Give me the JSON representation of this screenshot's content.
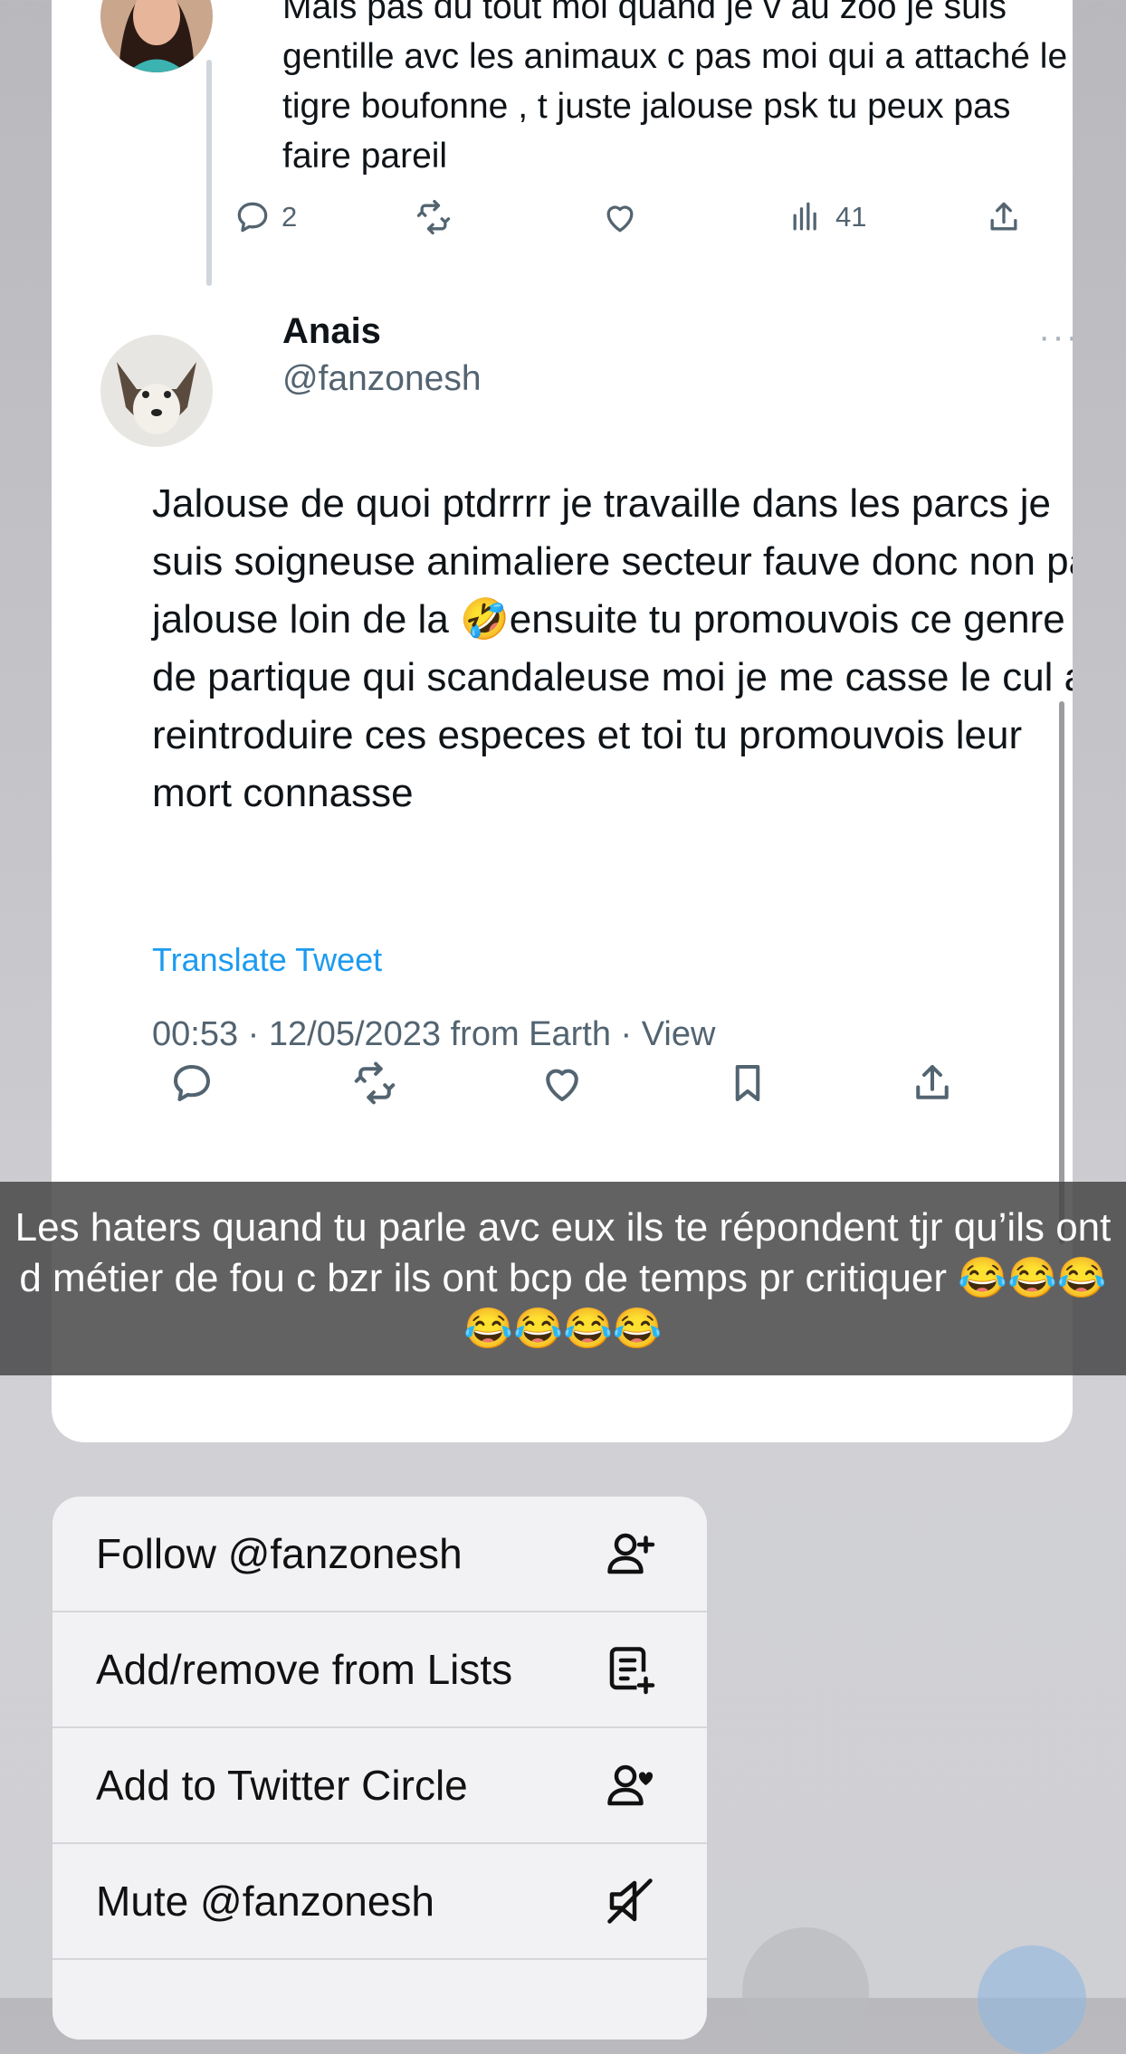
{
  "reply": {
    "text": "Mais pas du tout moi quand je v au zoo je suis gentille avc les animaux c pas moi qui a attaché le tigre boufonne , t juste jalouse psk tu peux pas faire pareil",
    "reply_count": "2",
    "view_count": "41"
  },
  "tweet": {
    "name": "Anais",
    "handle": "@fanzonesh",
    "text": "Jalouse de quoi ptdrrrr je travaille dans les parcs je suis soigneuse animaliere secteur fauve donc non pas jalouse loin de la 🤣ensuite tu promouvois ce genre de partique qui scandaleuse moi je me casse le cul a reintroduire ces especes et toi tu promouvois leur mort connasse",
    "translate_label": "Translate Tweet",
    "meta": "00:53 · 12/05/2023 from Earth · View",
    "more": "···"
  },
  "caption": "Les haters quand tu parle avc eux ils te répondent tjr qu’ils ont d métier de fou c bzr ils ont bcp de temps pr critiquer 😂😂😂😂😂😂😂",
  "menu": {
    "items": [
      {
        "label": "Follow @fanzonesh",
        "icon": "follow-user-icon"
      },
      {
        "label": "Add/remove from Lists",
        "icon": "list-add-icon"
      },
      {
        "label": "Add to Twitter Circle",
        "icon": "circle-user-icon"
      },
      {
        "label": "Mute @fanzonesh",
        "icon": "mute-icon"
      }
    ]
  },
  "colors": {
    "accent": "#1d9bf0",
    "secondary_text": "#536471",
    "caption_bg": "#464648"
  }
}
